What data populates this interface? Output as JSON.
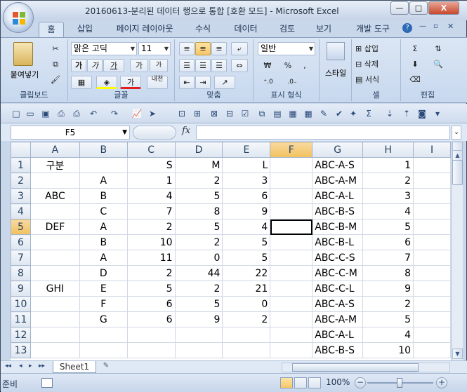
{
  "window": {
    "title": "20160613-분리된 데이터 행으로 통합  [호환 모드] - Microsoft Excel",
    "minimize": "—",
    "maximize": "□",
    "close": "X"
  },
  "ribbon_tabs": [
    {
      "label": "홈",
      "active": true
    },
    {
      "label": "삽입"
    },
    {
      "label": "페이지 레이아웃"
    },
    {
      "label": "수식"
    },
    {
      "label": "데이터"
    },
    {
      "label": "검토"
    },
    {
      "label": "보기"
    },
    {
      "label": "개발 도구"
    }
  ],
  "ribbon": {
    "clipboard": {
      "paste": "붙여넣기",
      "label": "클립보드"
    },
    "font": {
      "name": "맑은 고딕",
      "size": "11",
      "bold": "가",
      "italic": "가",
      "underline": "가",
      "grow": "가",
      "shrink": "가",
      "color": "가",
      "phonetic": "내천",
      "label": "글꼴"
    },
    "alignment": {
      "label": "맞춤"
    },
    "number": {
      "format": "일반",
      "currency": "₩",
      "percent": "%",
      "comma": ",",
      "label": "표시 형식"
    },
    "styles": {
      "label": "스타일"
    },
    "cells": {
      "insert": "삽입",
      "delete": "삭제",
      "format": "서식",
      "label": "셀"
    },
    "editing": {
      "sum": "Σ",
      "label": "편집"
    }
  },
  "formula_bar": {
    "name_box": "F5",
    "fx": "fx",
    "formula": ""
  },
  "columns": [
    "A",
    "B",
    "C",
    "D",
    "E",
    "F",
    "G",
    "H",
    "I"
  ],
  "selected_column": "F",
  "selected_row": "5",
  "rows": [
    {
      "n": "1",
      "a": "구분",
      "b": "",
      "c": "S",
      "d": "M",
      "e": "L",
      "f": "",
      "g": "ABC-A-S",
      "h": "1"
    },
    {
      "n": "2",
      "a": "",
      "b": "A",
      "c": "1",
      "d": "2",
      "e": "3",
      "f": "",
      "g": "ABC-A-M",
      "h": "2"
    },
    {
      "n": "3",
      "a": "ABC",
      "b": "B",
      "c": "4",
      "d": "5",
      "e": "6",
      "f": "",
      "g": "ABC-A-L",
      "h": "3"
    },
    {
      "n": "4",
      "a": "",
      "b": "C",
      "c": "7",
      "d": "8",
      "e": "9",
      "f": "",
      "g": "ABC-B-S",
      "h": "4"
    },
    {
      "n": "5",
      "a": "DEF",
      "b": "A",
      "c": "2",
      "d": "5",
      "e": "4",
      "f": "",
      "g": "ABC-B-M",
      "h": "5"
    },
    {
      "n": "6",
      "a": "",
      "b": "B",
      "c": "10",
      "d": "2",
      "e": "5",
      "f": "",
      "g": "ABC-B-L",
      "h": "6"
    },
    {
      "n": "7",
      "a": "",
      "b": "A",
      "c": "11",
      "d": "0",
      "e": "5",
      "f": "",
      "g": "ABC-C-S",
      "h": "7"
    },
    {
      "n": "8",
      "a": "",
      "b": "D",
      "c": "2",
      "d": "44",
      "e": "22",
      "f": "",
      "g": "ABC-C-M",
      "h": "8"
    },
    {
      "n": "9",
      "a": "GHI",
      "b": "E",
      "c": "5",
      "d": "2",
      "e": "21",
      "f": "",
      "g": "ABC-C-L",
      "h": "9"
    },
    {
      "n": "10",
      "a": "",
      "b": "F",
      "c": "6",
      "d": "5",
      "e": "0",
      "f": "",
      "g": "ABC-A-S",
      "h": "2"
    },
    {
      "n": "11",
      "a": "",
      "b": "G",
      "c": "6",
      "d": "9",
      "e": "2",
      "f": "",
      "g": "ABC-A-M",
      "h": "5"
    },
    {
      "n": "12",
      "a": "",
      "b": "",
      "c": "",
      "d": "",
      "e": "",
      "f": "",
      "g": "ABC-A-L",
      "h": "4"
    },
    {
      "n": "13",
      "a": "",
      "b": "",
      "c": "",
      "d": "",
      "e": "",
      "f": "",
      "g": "ABC-B-S",
      "h": "10"
    }
  ],
  "sheet_tabs": [
    {
      "label": "Sheet1"
    }
  ],
  "status": {
    "ready": "준비",
    "zoom": "100%"
  },
  "colors": {
    "selected_header": "#f1c15f",
    "grid_line": "#d0d7e5",
    "ribbon": "#c7d8ee"
  }
}
